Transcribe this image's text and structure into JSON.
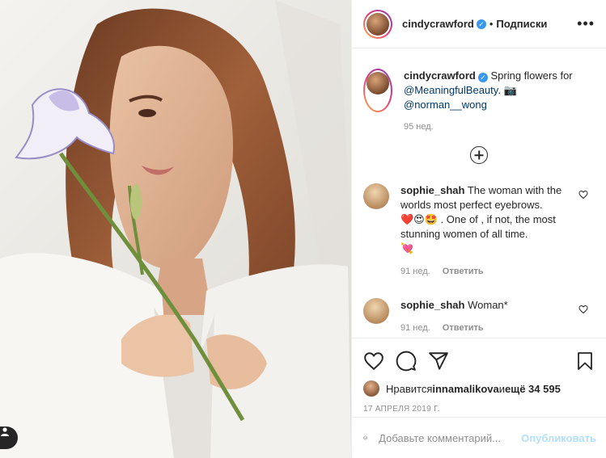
{
  "post": {
    "author": "cindycrawford",
    "separator": "•",
    "follow_label": "Подписки",
    "more_label": "•••"
  },
  "caption": {
    "username": "cindycrawford",
    "text_1": "Spring flowers for ",
    "mention_1": "@MeaningfulBeauty",
    "text_2": ". 📷 ",
    "mention_2": "@norman__wong",
    "age": "95 нед."
  },
  "comments": [
    {
      "username": "sophie_shah",
      "text_1": "The woman with the worlds most perfect eyebrows.",
      "text_2": "❤️😍🤩 . One of , if not, the most stunning women of all time.",
      "text_3": "💘",
      "age": "91 нед.",
      "reply": "Ответить"
    },
    {
      "username": "sophie_shah",
      "text_1": "Woman*",
      "age": "91 нед.",
      "reply": "Ответить"
    }
  ],
  "likes": {
    "prefix": "Нравится ",
    "user": "innamalikova",
    "middle": " и ",
    "count": "ещё 34 595"
  },
  "date": "17 АПРЕЛЯ 2019 Г.",
  "add_comment": {
    "placeholder": "Добавьте комментарий...",
    "post_label": "Опубликовать"
  },
  "colors": {
    "verified": "#3897f0",
    "mention": "#00376b",
    "post_disabled": "#b2dffc"
  }
}
